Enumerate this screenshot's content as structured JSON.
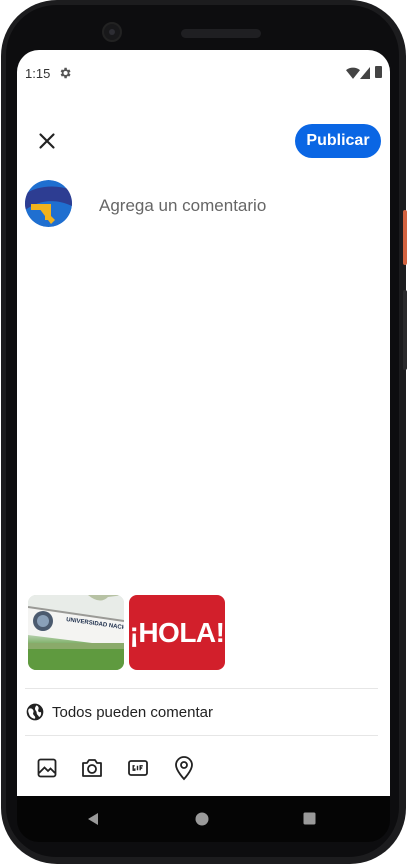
{
  "status_bar": {
    "time": "1:15",
    "settings_icon": "gear-icon",
    "wifi_icon": "wifi-icon",
    "signal_icon": "signal-icon",
    "battery_icon": "battery-icon"
  },
  "header": {
    "close_icon": "close-icon",
    "publish_label": "Publicar",
    "publish_color": "#0a66e4"
  },
  "composer": {
    "avatar_icon": "avatar",
    "placeholder": "Agrega un comentario"
  },
  "attachments": [
    {
      "name": "universidad-image",
      "caption": "UNIVERSIDAD NACIONAL"
    },
    {
      "name": "hola-image",
      "caption": "¡HOLA!"
    }
  ],
  "visibility": {
    "icon": "globe-icon",
    "label": "Todos pueden comentar"
  },
  "toolbar": [
    "image-icon",
    "camera-icon",
    "gif-icon",
    "location-icon"
  ],
  "system_nav": [
    "back-icon",
    "home-icon",
    "recents-icon"
  ]
}
